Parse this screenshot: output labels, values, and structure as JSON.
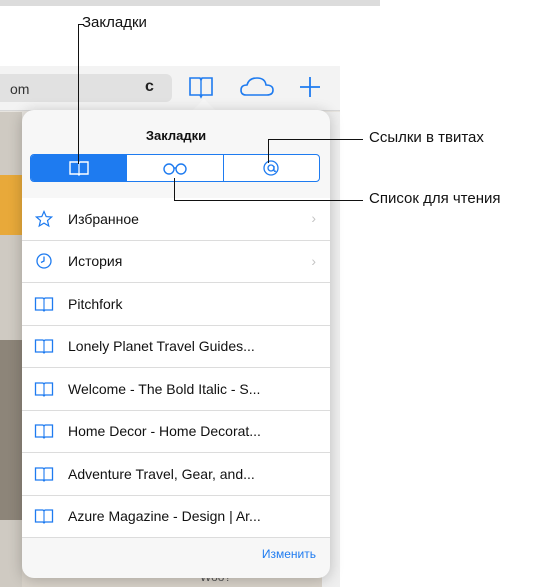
{
  "browser": {
    "address_text": "om",
    "reload_glyph": "c",
    "background_footer_text": "Woo?"
  },
  "popover": {
    "title": "Закладки",
    "segments": [
      {
        "icon": "book-icon",
        "active": true
      },
      {
        "icon": "glasses-icon",
        "active": false
      },
      {
        "icon": "at-icon",
        "active": false
      }
    ],
    "items": [
      {
        "label": "Избранное",
        "icon": "star-icon",
        "chevron": true
      },
      {
        "label": "История",
        "icon": "clock-icon",
        "chevron": true
      },
      {
        "label": "Pitchfork",
        "icon": "book-icon",
        "chevron": false
      },
      {
        "label": "Lonely Planet Travel Guides...",
        "icon": "book-icon",
        "chevron": false
      },
      {
        "label": "Welcome - The Bold Italic - S...",
        "icon": "book-icon",
        "chevron": false
      },
      {
        "label": "Home Decor - Home Decorat...",
        "icon": "book-icon",
        "chevron": false
      },
      {
        "label": "Adventure Travel, Gear, and...",
        "icon": "book-icon",
        "chevron": false
      },
      {
        "label": "Azure Magazine - Design | Ar...",
        "icon": "book-icon",
        "chevron": false
      }
    ],
    "edit_label": "Изменить"
  },
  "callouts": {
    "bookmarks": "Закладки",
    "twitter_links": "Ссылки в твитах",
    "reading_list": "Список для чтения"
  },
  "colors": {
    "accent": "#1e7bf0",
    "chevron": "#c4c4c4"
  }
}
